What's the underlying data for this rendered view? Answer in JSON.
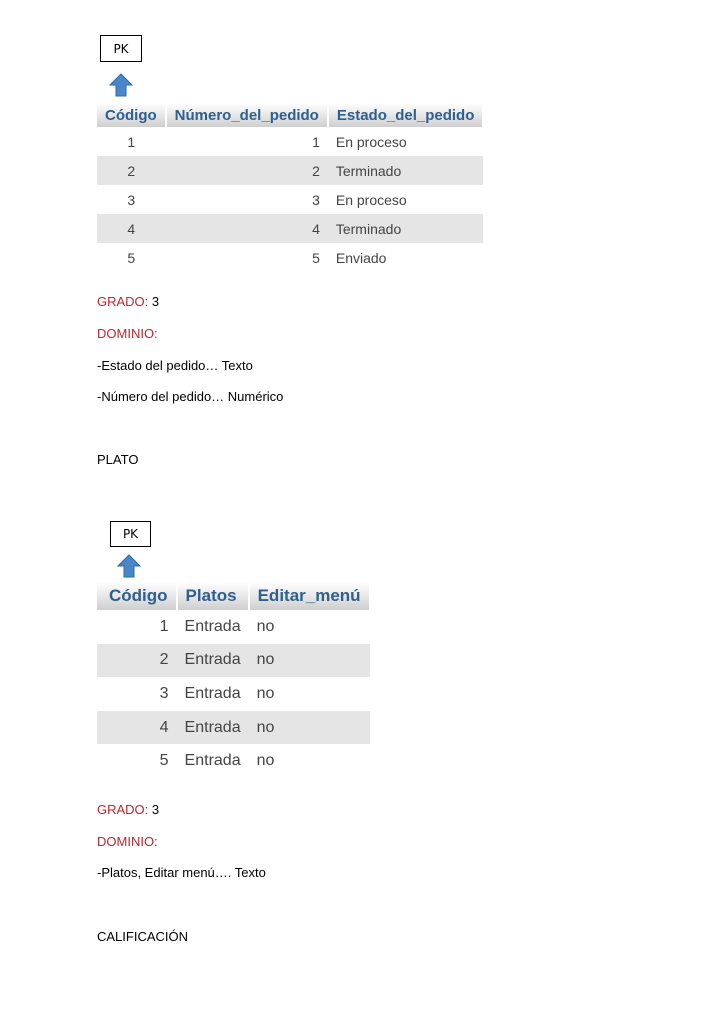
{
  "section1": {
    "pk_label": "PK",
    "table": {
      "headers": [
        "Código",
        "Número_del_pedido",
        "Estado_del_pedido"
      ],
      "rows": [
        [
          "1",
          "1",
          "En proceso"
        ],
        [
          "2",
          "2",
          "Terminado"
        ],
        [
          "3",
          "3",
          "En proceso"
        ],
        [
          "4",
          "4",
          "Terminado"
        ],
        [
          "5",
          "5",
          "Enviado"
        ]
      ]
    },
    "grado_label": "GRADO:",
    "grado_value": " 3",
    "dominio_label": "DOMINIO:",
    "dominio_lines": [
      "-Estado del pedido… Texto",
      "-Número del pedido… Numérico"
    ]
  },
  "plato_title": "PLATO",
  "section2": {
    "pk_label": "PK",
    "table": {
      "headers": [
        "Código",
        "Platos",
        "Editar_menú"
      ],
      "rows": [
        [
          "1",
          "Entrada",
          "no"
        ],
        [
          "2",
          "Entrada",
          "no"
        ],
        [
          "3",
          "Entrada",
          "no"
        ],
        [
          "4",
          "Entrada",
          "no"
        ],
        [
          "5",
          "Entrada",
          "no"
        ]
      ]
    },
    "grado_label": "GRADO:",
    "grado_value": " 3",
    "dominio_label": "DOMINIO:",
    "dominio_lines": [
      "-Platos, Editar menú…. Texto"
    ]
  },
  "calificacion_title": "CALIFICACIÓN",
  "colors": {
    "label_red": "#c0262d",
    "header_blue": "#2e5f8e",
    "arrow_blue": "#4a86c8"
  }
}
